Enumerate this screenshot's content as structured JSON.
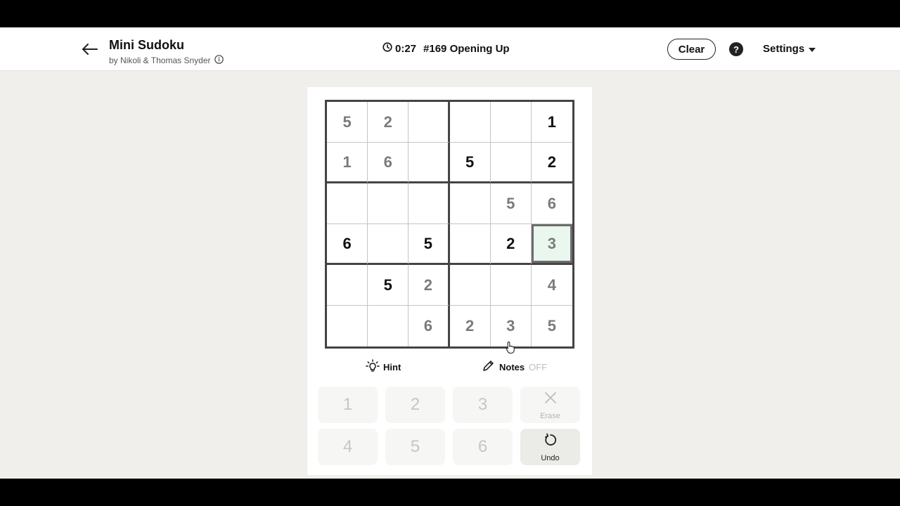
{
  "header": {
    "title": "Mini Sudoku",
    "byline": "by Nikoli & Thomas Snyder",
    "timer": "0:27",
    "puzzle": "#169 Opening Up",
    "clear_label": "Clear",
    "help_label": "?",
    "settings_label": "Settings"
  },
  "board": {
    "rows": [
      [
        "5",
        "2",
        "",
        "",
        "",
        "1"
      ],
      [
        "1",
        "6",
        "",
        "5",
        "",
        "2"
      ],
      [
        "",
        "",
        "",
        "",
        "5",
        "6"
      ],
      [
        "6",
        "",
        "5",
        "",
        "2",
        "3"
      ],
      [
        "",
        "5",
        "2",
        "",
        "",
        "4"
      ],
      [
        "",
        "",
        "6",
        "2",
        "3",
        "5"
      ]
    ],
    "given": [
      [
        0,
        0,
        0,
        0,
        0,
        1
      ],
      [
        0,
        0,
        0,
        1,
        0,
        1
      ],
      [
        0,
        0,
        0,
        0,
        0,
        0
      ],
      [
        1,
        0,
        1,
        0,
        1,
        0
      ],
      [
        0,
        1,
        0,
        0,
        0,
        0
      ],
      [
        0,
        0,
        0,
        0,
        0,
        0
      ]
    ],
    "selected": [
      3,
      5
    ]
  },
  "controls": {
    "hint_label": "Hint",
    "notes_label": "Notes",
    "notes_state": "OFF"
  },
  "keypad": {
    "keys": [
      "1",
      "2",
      "3",
      "4",
      "5",
      "6"
    ],
    "erase_label": "Erase",
    "undo_label": "Undo"
  }
}
